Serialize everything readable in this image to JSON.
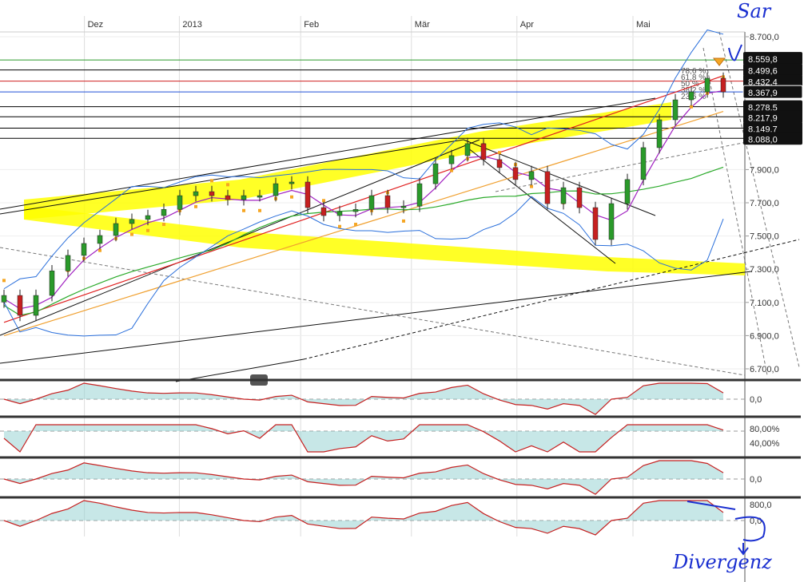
{
  "chart_data": {
    "type": "candlestick",
    "title": "",
    "x_months": [
      {
        "label": "Dez",
        "day": 16
      },
      {
        "label": "2013",
        "day": 34
      },
      {
        "label": "Feb",
        "day": 57
      },
      {
        "label": "Mär",
        "day": 78
      },
      {
        "label": "Apr",
        "day": 98
      },
      {
        "label": "Mai",
        "day": 120
      }
    ],
    "y_ticks": [
      "8.700,0",
      "7.900,0",
      "7.700,0",
      "7.500,0",
      "7.300,0",
      "7.100,0",
      "6.900,0",
      "6.700,0"
    ],
    "y_tick_values": [
      8700,
      7900,
      7700,
      7500,
      7300,
      7100,
      6900,
      6700
    ],
    "ylim": [
      6650,
      8800
    ],
    "closes": [
      7142,
      7022,
      7142,
      7290,
      7383,
      7455,
      7503,
      7575,
      7600,
      7623,
      7660,
      7743,
      7767,
      7743,
      7719,
      7743,
      7743,
      7815,
      7825,
      7671,
      7623,
      7647,
      7660,
      7743,
      7671,
      7680,
      7815,
      7935,
      7984,
      8056,
      7960,
      7912,
      7840,
      7888,
      7695,
      7791,
      7671,
      7479,
      7695,
      7840,
      8032,
      8200,
      8320,
      8368,
      8450,
      8368
    ],
    "levels": [
      {
        "value": 8559.8,
        "label": "8.559,8",
        "color": "#2a9a2a"
      },
      {
        "value": 8499.6,
        "label": "8.499,6",
        "color": "#000000"
      },
      {
        "value": 8432.4,
        "label": "8.432,4",
        "color": "#d02020"
      },
      {
        "value": 8367.9,
        "label": "8.367,9",
        "color": "#1f4fd8",
        "current": true
      },
      {
        "value": 8278.5,
        "label": "8.278,5",
        "color": "#000000"
      },
      {
        "value": 8217.9,
        "label": "8.217,9",
        "color": "#000000"
      },
      {
        "value": 8149.7,
        "label": "8.149,7",
        "color": "#000000"
      },
      {
        "value": 8088.0,
        "label": "8.088,0",
        "color": "#000000"
      }
    ],
    "fib_labels": [
      "78,6 %",
      "61,8 %",
      "50 %",
      "38,2 %",
      "23,6 %"
    ],
    "panels": [
      {
        "name": "macd",
        "ticks": [
          "0,0"
        ]
      },
      {
        "name": "stochastic",
        "ticks": [
          "80,00%",
          "40,00%"
        ]
      },
      {
        "name": "momentum",
        "ticks": [
          "0,0"
        ]
      },
      {
        "name": "oscillator",
        "ticks": [
          "800,0",
          "0,0"
        ]
      }
    ]
  },
  "annotations": {
    "sar": "Sar",
    "divergenz": "Divergenz"
  },
  "colors": {
    "up": "#2a9a2a",
    "down": "#c62020",
    "band": "#ffff00",
    "sar": "#f5a623",
    "bb": "#2a6fdb"
  }
}
